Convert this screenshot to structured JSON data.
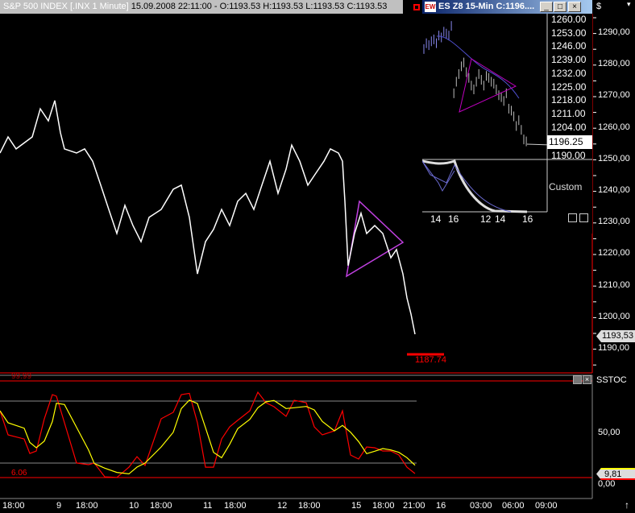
{
  "header": {
    "symbol": "S&P 500 INDEX [.INX  1 Minute]",
    "info": "15.09.2008 22:11:00 - O:1193.53 H:1193.53 L:1193.53 C:1193.53"
  },
  "inset": {
    "title": "ES Z8 15-Min C:1196....",
    "logo": "EW",
    "min": "_",
    "max": "□",
    "close": "×",
    "price_labels": [
      "1260.00",
      "1253.00",
      "1246.00",
      "1239.00",
      "1232.00",
      "1225.00",
      "1218.00",
      "1211.00",
      "1204.00",
      "1196.25",
      "1190.00"
    ],
    "current": "1196.25",
    "custom_label": "Custom",
    "time_labels": [
      "14",
      "16",
      "12",
      "14",
      "16"
    ],
    "closes": [
      1245,
      1248,
      1247,
      1249,
      1250,
      1248,
      1252,
      1251,
      1254,
      1253,
      1252,
      1257,
      1222,
      1228,
      1232,
      1236,
      1238,
      1233,
      1230,
      1226,
      1224,
      1228,
      1232,
      1229,
      1226,
      1231,
      1230,
      1228,
      1227,
      1224,
      1221,
      1220,
      1218,
      1222,
      1214,
      1213,
      1210,
      1205,
      1208,
      1203,
      1198,
      1197
    ]
  },
  "axis": {
    "currency": "$",
    "price_labels": [
      "1290,00",
      "1280,00",
      "1270,00",
      "1260,00",
      "1250,00",
      "1240,00",
      "1230,00",
      "1220,00",
      "1210,00",
      "1200,00",
      "1190,00"
    ],
    "last_price": "1193,53",
    "stoch_label": "SSTOC",
    "stoch_labels": [
      "50,00",
      "0,00"
    ],
    "stoch_last": "9,81"
  },
  "main": {
    "low_marker": "1187.74",
    "stoch_high": "99.99",
    "stoch_low": "6.06",
    "time_labels": [
      "18:00",
      "9",
      "18:00",
      "10",
      "18:00",
      "11",
      "18:00",
      "12",
      "18:00",
      "15",
      "18:00",
      "21:00",
      "16",
      "03:00",
      "06:00",
      "09:00"
    ]
  },
  "chart_data": {
    "type": "line",
    "title": "S&P 500 INDEX 1 Minute",
    "price": {
      "x": [
        0,
        10,
        20,
        40,
        50,
        60,
        68,
        75,
        80,
        95,
        105,
        115,
        125,
        135,
        145,
        155,
        165,
        175,
        185,
        200,
        215,
        225,
        235,
        245,
        255,
        265,
        275,
        285,
        295,
        305,
        315,
        325,
        335,
        345,
        355,
        362,
        372,
        382,
        392,
        402,
        410,
        420,
        425,
        428,
        432,
        440,
        448,
        455,
        465,
        475,
        485,
        492,
        500,
        505,
        510,
        515
      ],
      "y": [
        1252,
        1257.1,
        1253.3,
        1257.1,
        1266,
        1262.2,
        1268.6,
        1258.4,
        1253.3,
        1252,
        1253.3,
        1249.4,
        1241.8,
        1234.1,
        1226.5,
        1235.4,
        1229,
        1223.9,
        1231.6,
        1234.1,
        1240.5,
        1241.8,
        1231.6,
        1213.7,
        1223.9,
        1227.8,
        1234.1,
        1229,
        1236.7,
        1239.2,
        1234.1,
        1241.8,
        1249.4,
        1239.2,
        1246.9,
        1254.5,
        1249.4,
        1241.8,
        1245.6,
        1249.4,
        1253.3,
        1252,
        1249.4,
        1236.7,
        1216.3,
        1226.5,
        1232.9,
        1226.5,
        1229,
        1226.5,
        1218.8,
        1221.4,
        1213.7,
        1206.1,
        1201,
        1194.6
      ]
    },
    "stoch_k": {
      "x": [
        0,
        10,
        30,
        37,
        45,
        55,
        65,
        70,
        80,
        95,
        110,
        117,
        130,
        145,
        160,
        170,
        180,
        200,
        215,
        225,
        235,
        245,
        255,
        265,
        275,
        285,
        295,
        310,
        320,
        330,
        340,
        355,
        365,
        380,
        390,
        400,
        415,
        425,
        435,
        445,
        455,
        465,
        475,
        485,
        495,
        505,
        515
      ],
      "y": [
        71,
        47.6,
        43.6,
        29.5,
        31.9,
        63.2,
        86.7,
        85.2,
        59.3,
        20.2,
        18.6,
        20.2,
        6.8,
        6.1,
        16.2,
        26.4,
        17.8,
        63.2,
        69.5,
        86.7,
        88,
        59.3,
        16.2,
        16.2,
        43.6,
        55.4,
        61.7,
        71,
        89.1,
        78.9,
        75,
        65.6,
        81.2,
        78.9,
        55.4,
        47.6,
        51.5,
        71,
        28,
        24.1,
        35.8,
        35,
        31.9,
        31.9,
        28,
        16.2,
        10
      ]
    },
    "price_range": [
      1190,
      1290
    ],
    "stoch_range": [
      0,
      100
    ],
    "stoch_levels": [
      20,
      80
    ]
  }
}
